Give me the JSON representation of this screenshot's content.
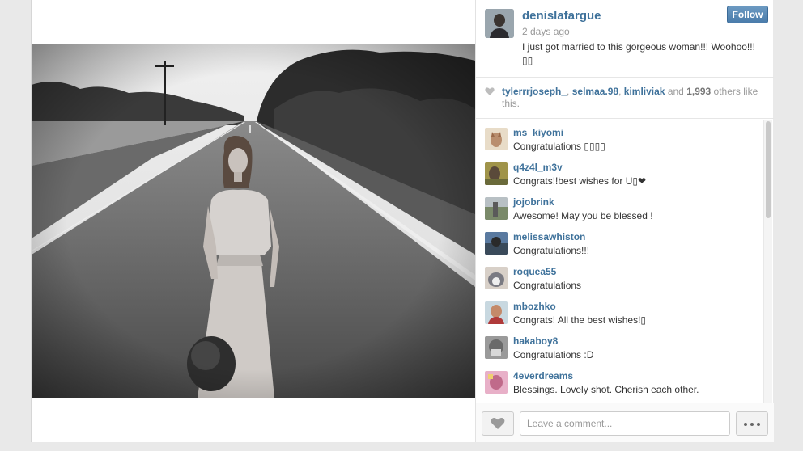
{
  "post": {
    "username": "denislafargue",
    "time_ago": "2 days ago",
    "caption": "I just got married to this gorgeous woman!!! Woohoo!!! ▯▯",
    "follow_label": "Follow"
  },
  "likes": {
    "users": [
      "tylerrrjoseph_",
      "selmaa.98",
      "kimliviak"
    ],
    "sep1": ", ",
    "sep2": ", ",
    "and_text": " and ",
    "count": "1,993",
    "suffix": " others like this."
  },
  "comments": [
    {
      "user": "ms_kiyomi",
      "text": "Congratulations ▯▯▯▯",
      "avatar_color": "#b98e6e"
    },
    {
      "user": "q4z4l_m3v",
      "text": "Congrats!!best wishes for U▯❤",
      "avatar_color": "#5a4a3a"
    },
    {
      "user": "jojobrink",
      "text": "Awesome! May you be blessed !",
      "avatar_color": "#8a9a7a"
    },
    {
      "user": "melissawhiston",
      "text": "Congratulations!!!",
      "avatar_color": "#4a6a8a"
    },
    {
      "user": "roquea55",
      "text": "Congratulations",
      "avatar_color": "#7a7a82"
    },
    {
      "user": "mbozhko",
      "text": "Congrats! All the best wishes!▯",
      "avatar_color": "#c48a6a"
    },
    {
      "user": "hakaboy8",
      "text": "Congratulations :D",
      "avatar_color": "#6a6a6a"
    },
    {
      "user": "4everdreams",
      "text": "Blessings. Lovely shot. Cherish each other.",
      "avatar_color": "#c06a8a"
    }
  ],
  "composer": {
    "placeholder": "Leave a comment..."
  },
  "icons": {
    "like": "heart-icon",
    "more": "ellipsis-icon"
  },
  "colors": {
    "link": "#3f729b",
    "follow_button": "#4a7cab"
  }
}
